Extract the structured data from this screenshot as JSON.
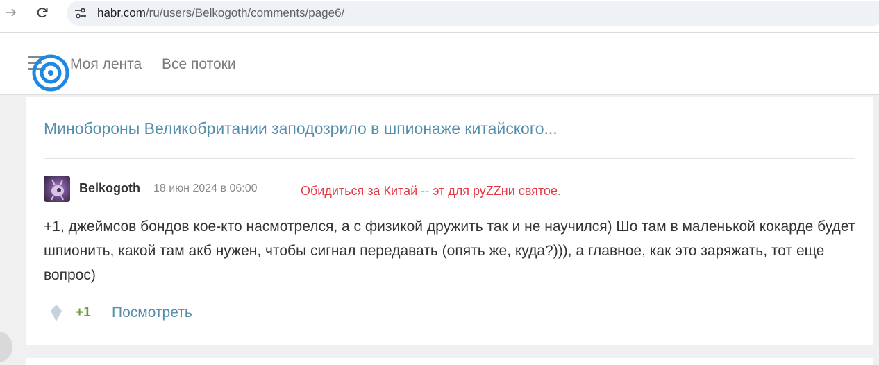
{
  "browser": {
    "url_domain": "habr.com",
    "url_path": "/ru/users/Belkogoth/comments/page6/",
    "icons": {
      "back": "arrow-right-icon",
      "reload": "reload-icon",
      "site_info": "tune-icon"
    }
  },
  "header": {
    "nav": [
      "Моя лента",
      "Все потоки"
    ],
    "icons": {
      "menu": "hamburger-icon",
      "logo": "target-logo-icon"
    }
  },
  "comment": {
    "post_title": "Минобороны Великобритании заподозрило в шпионаже китайского...",
    "username": "Belkogoth",
    "date": "18 июн 2024 в 06:00",
    "annotation": "Обидиться за Китай -- эт для руZZни святое.",
    "body": "+1, джеймсов бондов кое-кто насмотрелся, а с физикой дружить так и не научился) Шо там в маленькой кокарде будет шпионить, какой там акб нужен, чтобы сигнал передавать (опять же, куда?))), а главное, как это заряжать, тот еще вопрос)",
    "score": "+1",
    "view_label": "Посмотреть"
  },
  "colors": {
    "link": "#548eaa",
    "score": "#6c9d31",
    "annotation": "#e63946",
    "logo": "#1e88e5"
  }
}
